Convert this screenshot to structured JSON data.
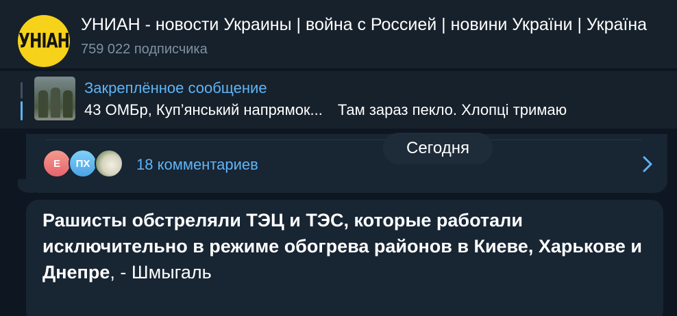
{
  "header": {
    "avatar_text": "УНІАН",
    "title": "УНИАН - новости Украины | война с Россией | новини України | Україна",
    "subscribers": "759 022 подписчика"
  },
  "pinned": {
    "label": "Закреплённое сообщение",
    "text_part1": "43 ОМБр, Куп’янський напрямок...",
    "text_part2": "Там зараз пекло. Хлопці тримаю"
  },
  "comments": {
    "avatar1_initial": "Е",
    "avatar2_initial": "ПХ",
    "count_label": "18 комментариев"
  },
  "date_pill": "Сегодня",
  "message": {
    "bold_text": "Рашисты обстреляли ТЭЦ и ТЭС, которые работали исключительно в режиме обогрева районов в Киеве, Харькове и Днепре",
    "regular_text": ", - Шмыгаль"
  },
  "colors": {
    "background": "#0e1621",
    "panel": "#17212b",
    "bubble": "#182533",
    "accent": "#5eb5f7",
    "muted": "#7f91a4",
    "avatar_yellow": "#f6d21a"
  },
  "icons": [
    "channel-avatar",
    "pinned-thumbnail",
    "chevron-right-icon"
  ]
}
